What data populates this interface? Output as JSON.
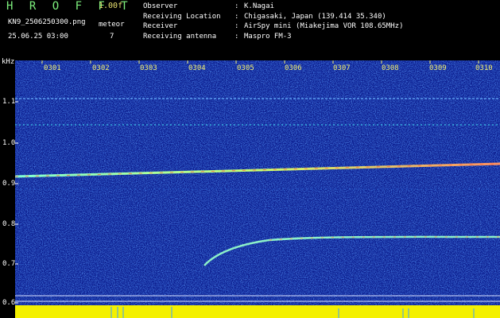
{
  "header": {
    "app_title": "H R O F F T",
    "version": "1.00f",
    "filename": "KN9_2506250300.png",
    "mode_label": "meteor",
    "datetime": "25.06.25 03:00",
    "mode_value": "7"
  },
  "info": [
    {
      "key": "Observer",
      "value": "K.Nagai"
    },
    {
      "key": "Receiving Location",
      "value": "Chigasaki, Japan (139.414 35.340)"
    },
    {
      "key": "Receiver",
      "value": "AirSpy mini (Miakejima VOR 108.65MHz)"
    },
    {
      "key": "Receiving antenna",
      "value": "Maspro FM-3"
    }
  ],
  "axis": {
    "unit": "kHz",
    "time_ticks": [
      "0301",
      "0302",
      "0303",
      "0304",
      "0305",
      "0306",
      "0307",
      "0308",
      "0309",
      "0310"
    ],
    "freq_ticks": [
      "1.1",
      "1.0",
      "0.9",
      "0.8",
      "0.7",
      "0.6"
    ]
  },
  "colors": {
    "background": "#000000",
    "plot_base": "#0a1a8c",
    "title_green": "#7df07d",
    "axis_yellow": "#f4f070",
    "amplitude_yellow": "#f4f000"
  }
}
